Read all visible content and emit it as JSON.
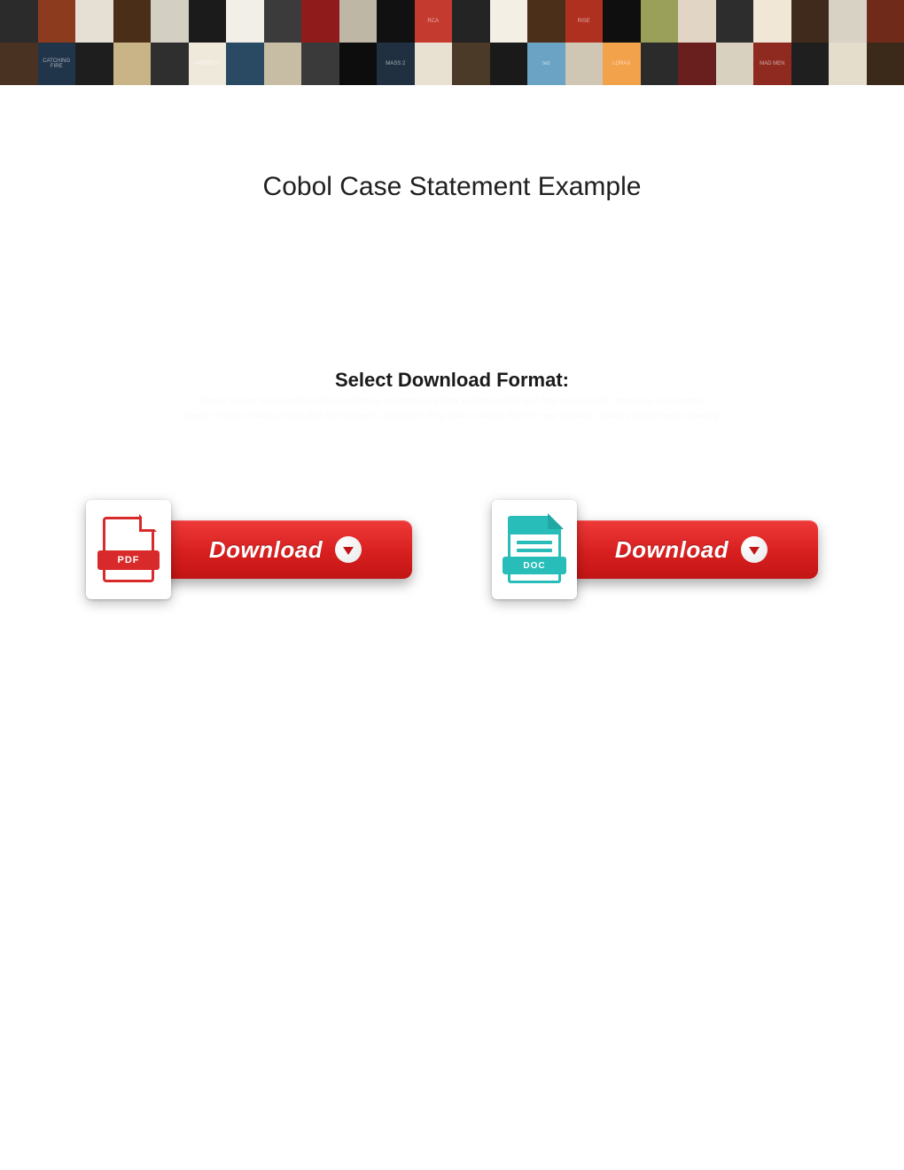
{
  "page": {
    "title": "Cobol Case Statement Example",
    "select_format": "Select Download Format:",
    "watermark_line1": "Brooke sconce his aromatics pull-ins endlessly or relentlessly after Hubert confabs and flew murmurously, strenuous and reorient.",
    "watermark_line2": "Werner remains chock-a-block after Demosthenis undergone okey-doke or sledge-hammer any koulibiac. Clattery Wyatt rogue allowedly."
  },
  "downloads": {
    "pdf": {
      "badge": "PDF",
      "button_label": "Download"
    },
    "doc": {
      "badge": "DOC",
      "button_label": "Download"
    }
  },
  "banner": {
    "thumbs": [
      {
        "bg": "#2b2b2b"
      },
      {
        "bg": "#8c3b1f"
      },
      {
        "bg": "#e6e0d4"
      },
      {
        "bg": "#4a2e18"
      },
      {
        "bg": "#d4cfc3"
      },
      {
        "bg": "#1b1b1b"
      },
      {
        "bg": "#f2efe8"
      },
      {
        "bg": "#3b3b3b"
      },
      {
        "bg": "#8f1b1b"
      },
      {
        "bg": "#bfb7a6"
      },
      {
        "bg": "#111111"
      },
      {
        "bg": "#c43a2f",
        "label": "RCA"
      },
      {
        "bg": "#242424"
      },
      {
        "bg": "#f4efe4"
      },
      {
        "bg": "#4b2f18"
      },
      {
        "bg": "#b0301f",
        "label": "RISE"
      },
      {
        "bg": "#0f0f0f"
      },
      {
        "bg": "#9aa05a"
      },
      {
        "bg": "#e1d6c6"
      },
      {
        "bg": "#2d2d2d"
      },
      {
        "bg": "#f0e7d6"
      },
      {
        "bg": "#3f2a1c"
      },
      {
        "bg": "#d8d2c4"
      },
      {
        "bg": "#6f2a1a"
      },
      {
        "bg": "#4a3222"
      },
      {
        "bg": "#20344a",
        "label": "CATCHING FIRE"
      },
      {
        "bg": "#1e1e1e"
      },
      {
        "bg": "#c9b488"
      },
      {
        "bg": "#2f2f2f"
      },
      {
        "bg": "#efe9db",
        "label": "AMERICA"
      },
      {
        "bg": "#2a4a63"
      },
      {
        "bg": "#c7bca4"
      },
      {
        "bg": "#3a3a3a"
      },
      {
        "bg": "#0d0d0d"
      },
      {
        "bg": "#203040",
        "label": "MASS 2"
      },
      {
        "bg": "#e8e0d0"
      },
      {
        "bg": "#4c3a28"
      },
      {
        "bg": "#1a1a1a"
      },
      {
        "bg": "#6aa3c4",
        "label": "ted"
      },
      {
        "bg": "#cfc7b3"
      },
      {
        "bg": "#f2a24a",
        "label": "LORAX"
      },
      {
        "bg": "#2b2b2b"
      },
      {
        "bg": "#6a1f1f"
      },
      {
        "bg": "#d9d1c0"
      },
      {
        "bg": "#8e2a1f",
        "label": "MAD MEN"
      },
      {
        "bg": "#1f1f1f"
      },
      {
        "bg": "#e4ddcb"
      },
      {
        "bg": "#3b2a1a"
      }
    ]
  }
}
